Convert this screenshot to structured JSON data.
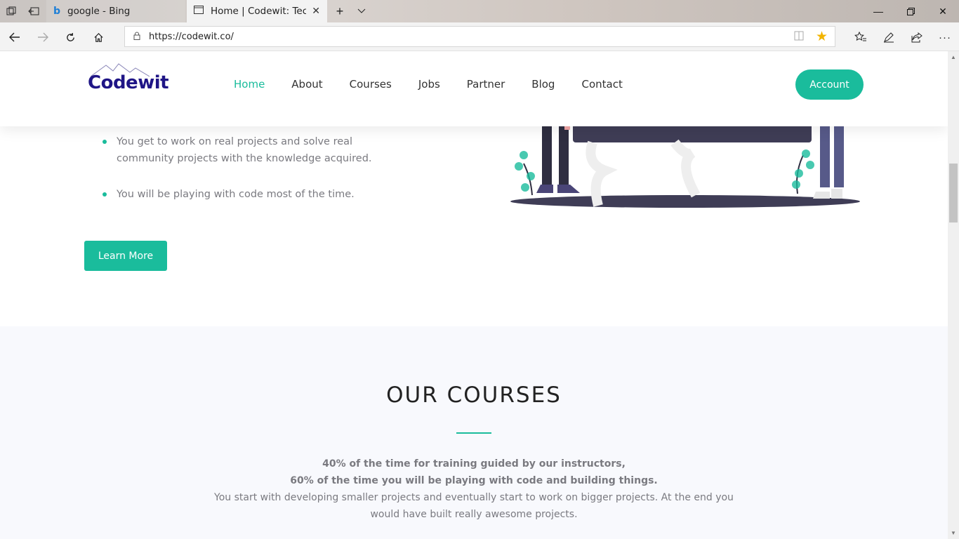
{
  "browser": {
    "tabs": [
      {
        "label": "google - Bing",
        "active": false
      },
      {
        "label": "Home | Codewit: Technology",
        "active": true
      }
    ],
    "url": "https://codewit.co/"
  },
  "site": {
    "logo_text": "Codewit",
    "nav": [
      "Home",
      "About",
      "Courses",
      "Jobs",
      "Partner",
      "Blog",
      "Contact"
    ],
    "active_nav": "Home",
    "account_label": "Account",
    "accent_color": "#1abc9c",
    "logo_color": "#1f1586"
  },
  "intro": {
    "bullets": [
      "You get to work on real projects and solve real community projects with the knowledge acquired.",
      "You will be playing with code most of the time."
    ],
    "learn_more_label": "Learn More"
  },
  "courses": {
    "title": "OUR COURSES",
    "line1": "40% of the time for training guided by our instructors,",
    "line2": "60% of the time you will be playing with code and building things.",
    "line3": "You start with developing smaller projects and eventually start to work on bigger projects. At the end you would have built really awesome projects."
  }
}
